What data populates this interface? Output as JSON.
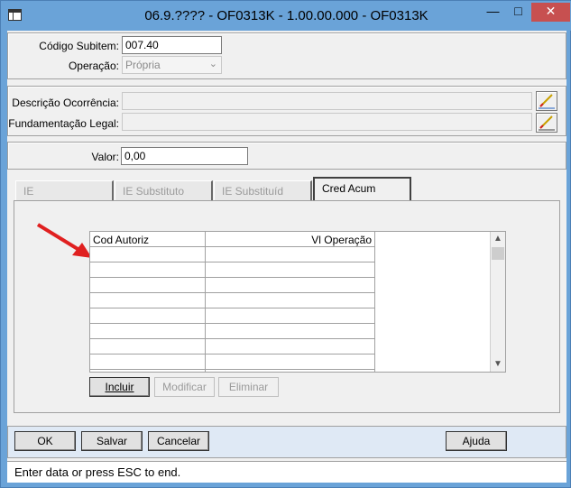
{
  "window": {
    "title": "06.9.???? - OF0313K - 1.00.00.000 - OF0313K",
    "minimize_glyph": "—",
    "maximize_glyph": "□",
    "close_glyph": "✕"
  },
  "form": {
    "codigo_subitem_label": "Código Subitem:",
    "codigo_subitem_value": "007.40",
    "operacao_label": "Operação:",
    "operacao_value": "Própria",
    "descricao_label": "Descrição Ocorrência:",
    "descricao_value": "",
    "fundamentacao_label": "Fundamentação Legal:",
    "fundamentacao_value": "",
    "valor_label": "Valor:",
    "valor_value": "0,00"
  },
  "tabs": [
    {
      "label": "IE"
    },
    {
      "label": "IE Substituto"
    },
    {
      "label": "IE Substituíd"
    },
    {
      "label": "Cred Acum"
    }
  ],
  "grid": {
    "columns": [
      "Cod Autoriz",
      "Vl Operação"
    ],
    "rows": [
      [
        "",
        ""
      ],
      [
        "",
        ""
      ],
      [
        "",
        ""
      ],
      [
        "",
        ""
      ],
      [
        "",
        ""
      ],
      [
        "",
        ""
      ],
      [
        "",
        ""
      ],
      [
        "",
        ""
      ]
    ]
  },
  "grid_buttons": {
    "incluir": "Incluir",
    "modificar": "Modificar",
    "eliminar": "Eliminar"
  },
  "footer_buttons": {
    "ok": "OK",
    "salvar": "Salvar",
    "cancelar": "Cancelar",
    "ajuda": "Ajuda"
  },
  "status": {
    "text": "Enter data or press ESC to end."
  },
  "colors": {
    "titlebar": "#6aa3d8",
    "close_button": "#c75050",
    "annotation_arrow": "#e02020"
  }
}
